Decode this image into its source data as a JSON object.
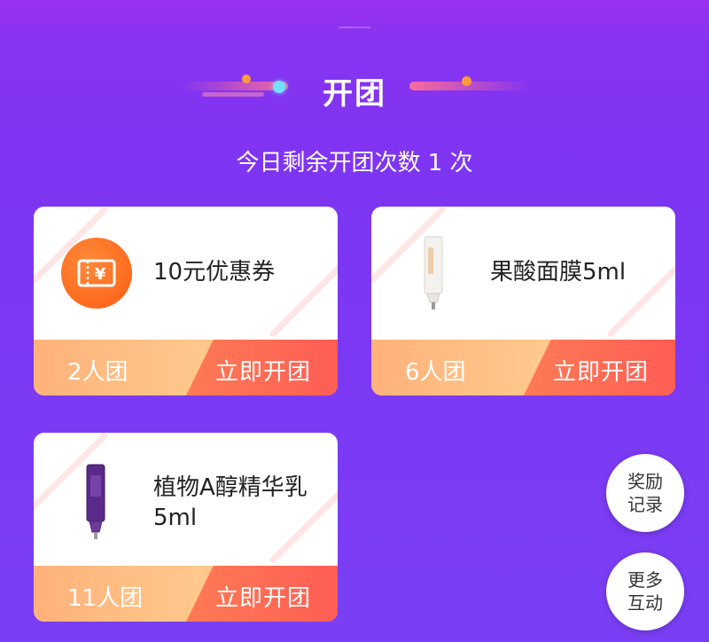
{
  "header": {
    "title": "开团",
    "subtitle": "今日剩余开团次数 1 次"
  },
  "cards": [
    {
      "name": "10元优惠券",
      "group_size": "2人团",
      "button": "立即开团",
      "icon": "coupon-icon"
    },
    {
      "name": "果酸面膜5ml",
      "group_size": "6人团",
      "button": "立即开团",
      "icon": "tube-white-icon"
    },
    {
      "name": "植物A醇精华乳5ml",
      "group_size": "11人团",
      "button": "立即开团",
      "icon": "tube-purple-icon"
    }
  ],
  "floating": {
    "rewards": "奖励记录",
    "more": "更多互动"
  },
  "colors": {
    "background": "#7d35f2",
    "accent_orange": "#ff6a1e",
    "button_red": "#ff5e55"
  }
}
